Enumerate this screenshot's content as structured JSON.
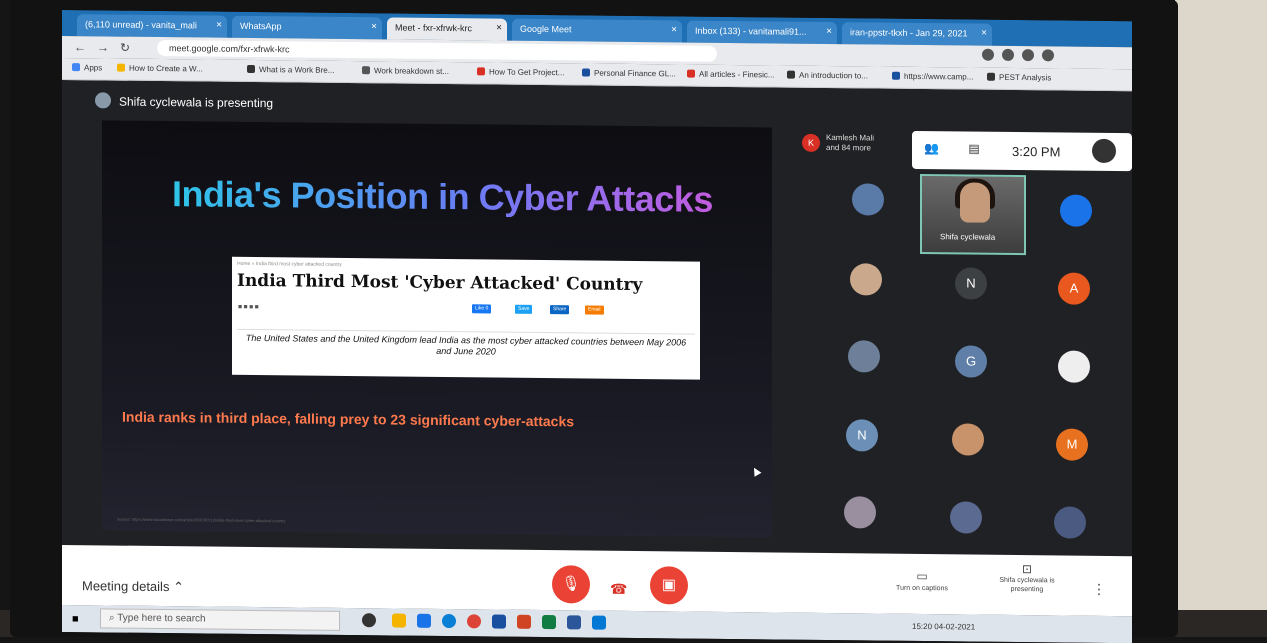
{
  "browser": {
    "tabs": [
      {
        "label": "(6,110 unread) - vanita_mali"
      },
      {
        "label": "WhatsApp"
      },
      {
        "label": "Meet - fxr-xfrwk-krc"
      },
      {
        "label": "Google Meet"
      },
      {
        "label": "Inbox (133) - vanitamali91..."
      },
      {
        "label": "iran-ppstr-tkxh - Jan 29, 2021"
      }
    ],
    "url": "meet.google.com/fxr-xfrwk-krc",
    "bookmarks": [
      "Apps",
      "How to Create a W...",
      "What is a Work Bre...",
      "Work breakdown st...",
      "How To Get Project...",
      "Personal Finance GL...",
      "All articles - Finesic...",
      "An introduction to...",
      "https://www.camp...",
      "PEST Analysis"
    ]
  },
  "meet": {
    "presenting_label": "Shifa cyclewala is presenting",
    "participants_label": "Kamlesh Mali and 84 more",
    "time": "3:20 PM",
    "presenter_name": "Shifa cyclewala",
    "tiles": [
      {
        "initial": "",
        "color": "#5a7aa8"
      },
      {
        "initial": "",
        "color": "#1a73e8"
      },
      {
        "initial": "",
        "color": "#c9a88b"
      },
      {
        "initial": "N",
        "color": "#3c4043"
      },
      {
        "initial": "A",
        "color": "#e8581f"
      },
      {
        "initial": "",
        "color": "#6d7f99"
      },
      {
        "initial": "G",
        "color": "#5f7fa8"
      },
      {
        "initial": "",
        "color": "#eeeeee"
      },
      {
        "initial": "N",
        "color": "#6c8fb8"
      },
      {
        "initial": "",
        "color": "#c8936a"
      },
      {
        "initial": "M",
        "color": "#e8711f"
      },
      {
        "initial": "",
        "color": "#9a8f9f"
      },
      {
        "initial": "",
        "color": "#5a6a90"
      },
      {
        "initial": "",
        "color": "#4a5a80"
      }
    ]
  },
  "slide": {
    "title": "India's Position in Cyber Attacks",
    "article_crumb": "Home » India third most cyber attacked country",
    "article_headline": "India Third Most 'Cyber Attacked' Country",
    "article_caption": "The United States and the United Kingdom lead India as the most cyber attacked countries between May 2006 and June 2020",
    "share_like": "Like 0",
    "share_save": "Save",
    "share_share": "Share",
    "share_email": "Email",
    "ranks_text": "India ranks in third place, falling prey to 23 significant cyber-attacks",
    "source": "Source: https://www.cisoadvisor.com/article/2020/07/13/india-third-most-cyber-attacked-country"
  },
  "controls": {
    "meeting_details": "Meeting details",
    "captions_label": "Turn on captions",
    "presenting_btn": "Shifa cyclewala is presenting"
  },
  "taskbar": {
    "search_placeholder": "Type here to search",
    "tray": "15:20  04-02-2021"
  }
}
